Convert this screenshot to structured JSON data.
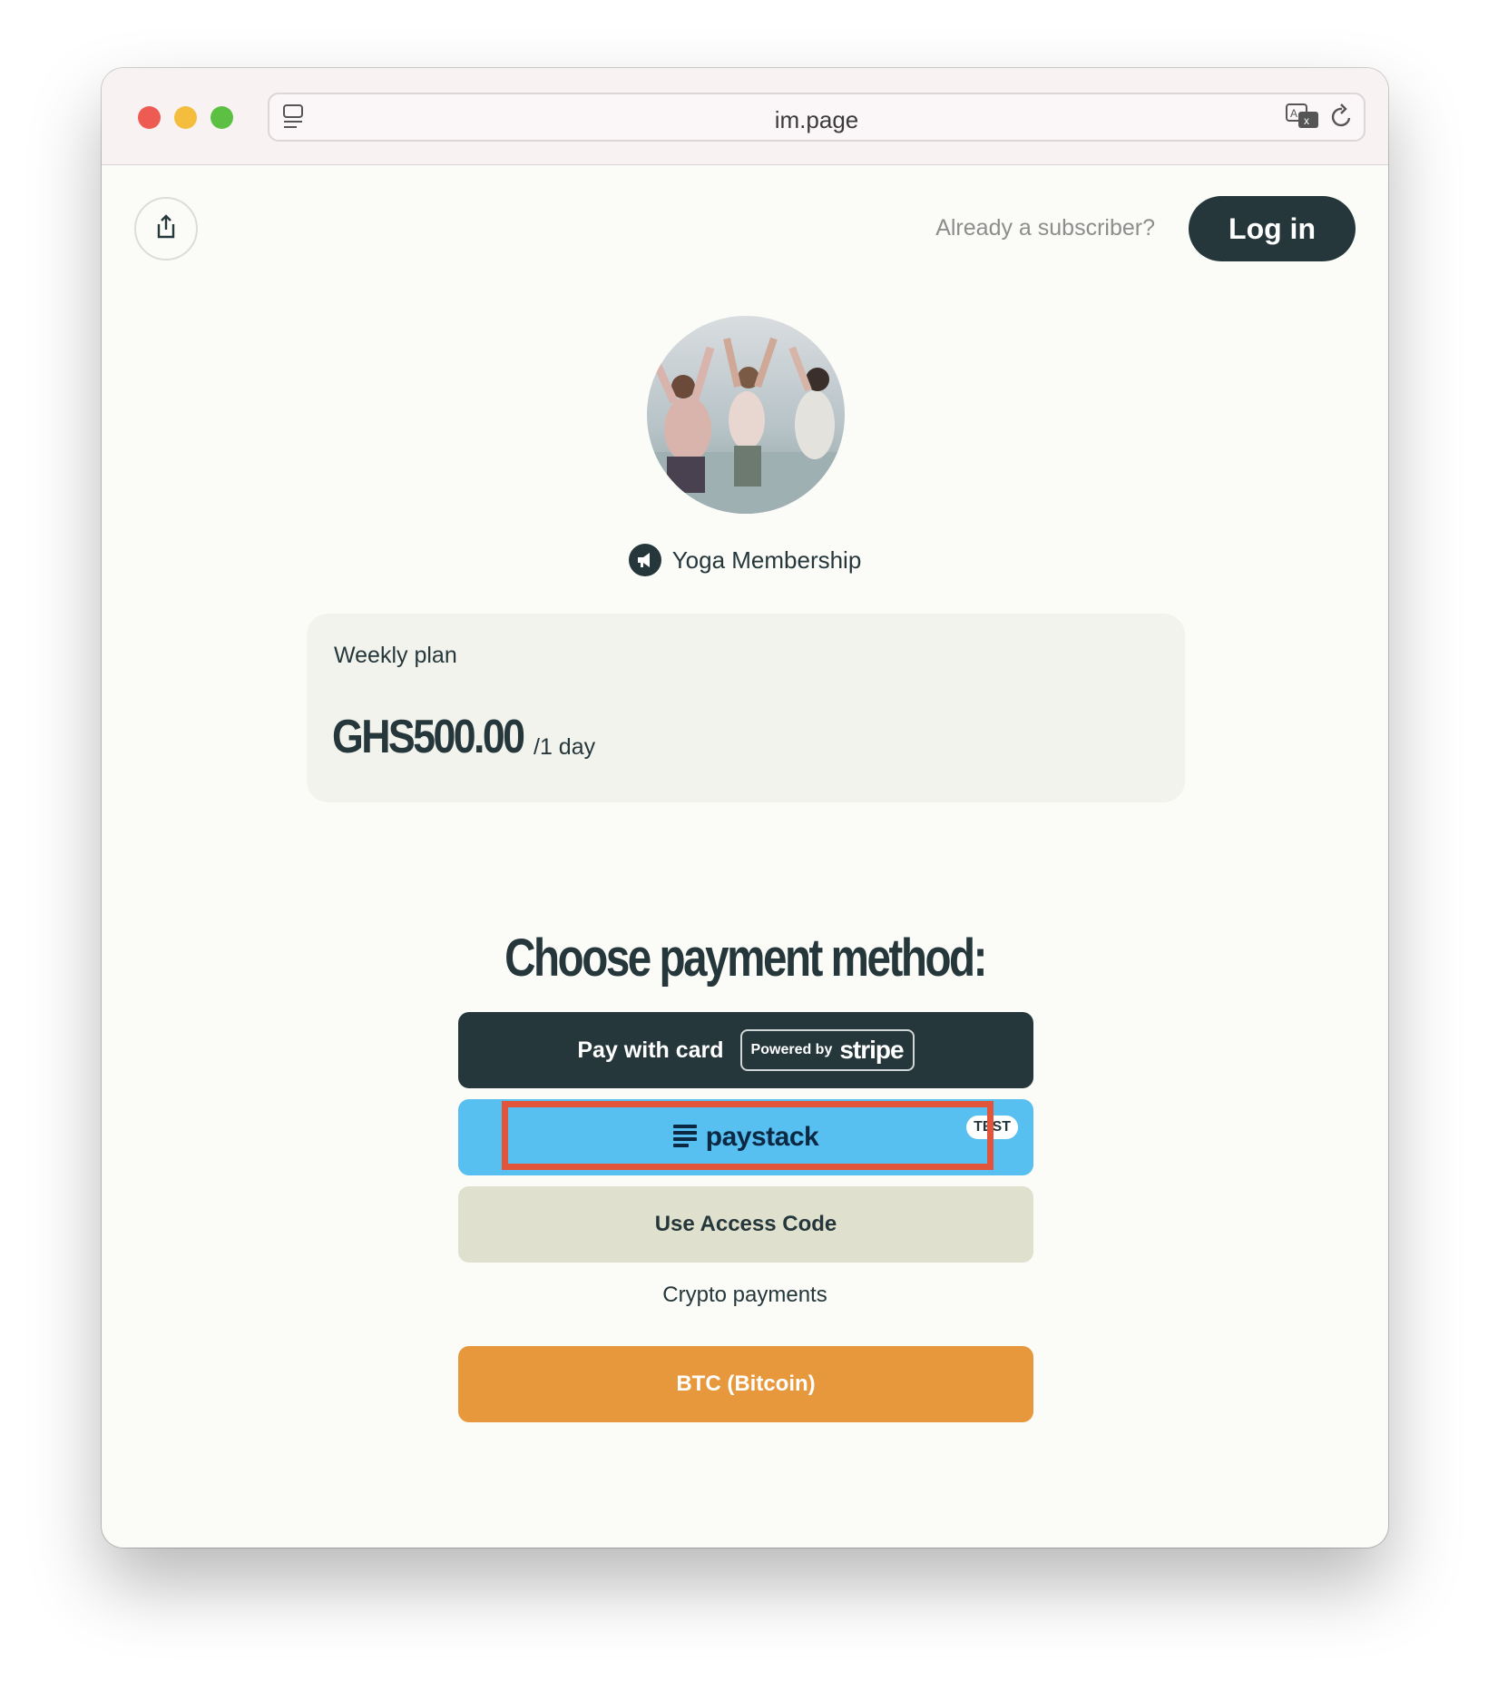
{
  "browser": {
    "url": "im.page"
  },
  "header": {
    "subscriber_prompt": "Already a subscriber?",
    "login_label": "Log in"
  },
  "brand": {
    "name": "Yoga Membership"
  },
  "plan": {
    "name": "Weekly plan",
    "price": "GHS500.00",
    "period": "/1 day"
  },
  "payment": {
    "heading": "Choose payment method:",
    "card": {
      "label": "Pay with card",
      "powered_by": "Powered by",
      "provider": "stripe"
    },
    "paystack": {
      "label": "paystack",
      "badge": "TEST"
    },
    "access_code_label": "Use Access Code",
    "crypto_heading": "Crypto payments",
    "btc_label": "BTC (Bitcoin)"
  },
  "colors": {
    "dark": "#25373b",
    "paystack_blue": "#58bff1",
    "access_beige": "#dfe0cd",
    "btc_orange": "#e8983c",
    "highlight_red": "#e2553a"
  },
  "icons": [
    "sidebar-icon",
    "translate-icon",
    "reload-icon",
    "share-icon",
    "megaphone-icon",
    "paystack-logo-icon"
  ]
}
